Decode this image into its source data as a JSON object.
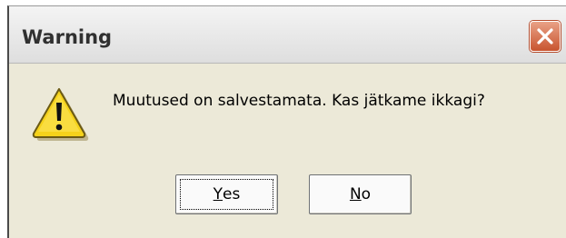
{
  "dialog": {
    "title": "Warning",
    "message": "Muutused on salvestamata. Kas jätkame ikkagi?",
    "icon": "warning-icon",
    "close_icon": "close-icon",
    "buttons": {
      "yes": {
        "mnemonic": "Y",
        "rest": "es"
      },
      "no": {
        "mnemonic": "N",
        "rest": "o"
      }
    },
    "colors": {
      "dialog_bg": "#ece9d8",
      "close_button": "#c8542f",
      "warning_yellow": "#f5d21b"
    }
  }
}
